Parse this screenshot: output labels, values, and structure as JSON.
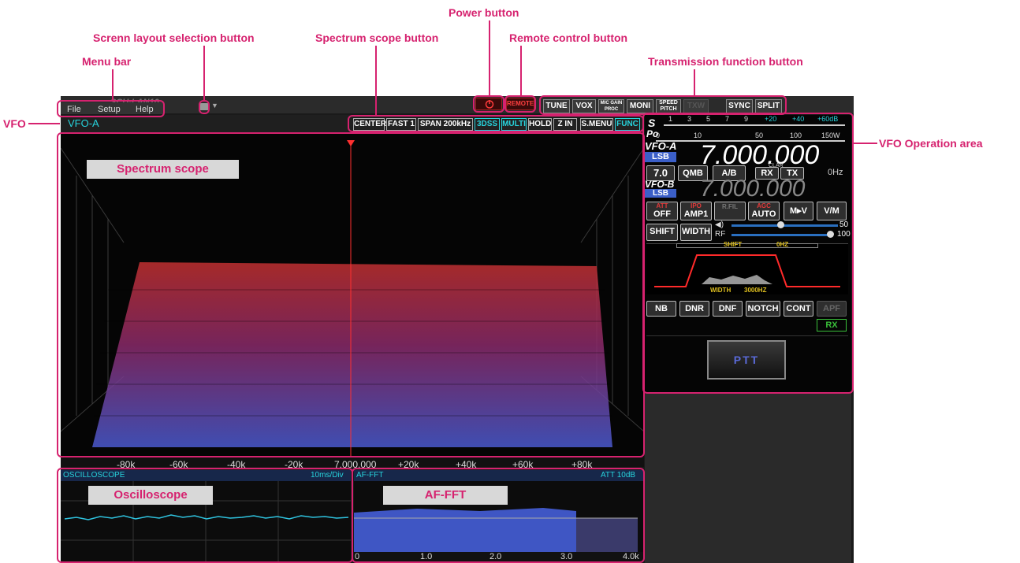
{
  "callouts": {
    "power": "Power button",
    "layout": "Screnn layout selection button",
    "scope_btn": "Spectrum scope button",
    "remote": "Remote control button",
    "menu": "Menu bar",
    "tx": "Transmission function button",
    "vfo": "VFO",
    "vfo_op": "VFO Operation area"
  },
  "app": {
    "title": "SCU-LAN10",
    "menu": [
      "File",
      "Setup",
      "Help"
    ],
    "vfo_label": "VFO-A",
    "remote_label": "REMOTE"
  },
  "tx_buttons": [
    "TUNE",
    "VOX",
    "MIC GAIN PROC",
    "MONI",
    "SPEED PITCH",
    "TXW",
    "SYNC",
    "SPLIT"
  ],
  "scope_buttons": [
    "CENTER",
    "FAST 1",
    "SPAN 200kHz",
    "3DSS",
    "MULTI",
    "HOLD",
    "Z IN",
    "S.MENU",
    "FUNC"
  ],
  "spectrum": {
    "label": "Spectrum scope",
    "ticks": [
      "-80k",
      "-60k",
      "-40k",
      "-20k",
      "7.000.000",
      "+20k",
      "+40k",
      "+60k",
      "+80k"
    ]
  },
  "oscilloscope": {
    "header": "OSCILLOSCOPE",
    "rate": "10ms/Div",
    "label": "Oscilloscope"
  },
  "affft": {
    "header": "AF-FFT",
    "att": "ATT 10dB",
    "label": "AF-FFT",
    "ticks": [
      "0",
      "1.0",
      "2.0",
      "3.0",
      "4.0k"
    ]
  },
  "vfo_panel": {
    "s_label": "S",
    "s_scale": [
      "1",
      "3",
      "5",
      "7",
      "9",
      "+20",
      "+40",
      "+60dB"
    ],
    "po_label": "Po",
    "po_scale": [
      "0",
      "10",
      "50",
      "100",
      "150W"
    ],
    "vfo_a": "VFO-A",
    "mode_a": "LSB",
    "freq_a": "7.000.000",
    "band": "7.0",
    "qmb": "QMB",
    "ab": "A/B",
    "clar": "CLAR",
    "rx": "RX",
    "tx": "TX",
    "clar_hz": "0Hz",
    "vfo_b": "VFO-B",
    "mode_b": "LSB",
    "freq_b": "7.000.000",
    "att_top": "ATT",
    "att_val": "OFF",
    "ipo_top": "IPO",
    "ipo_val": "AMP1",
    "rfil": "R.FIL",
    "agc_top": "AGC",
    "agc_val": "AUTO",
    "mv": "M▸V",
    "vm": "V/M",
    "shift": "SHIFT",
    "width": "WIDTH",
    "af_val": "50",
    "rf_label": "RF",
    "rf_val": "100",
    "shift_bar": "SHIFT",
    "shift_hz": "0HZ",
    "width_text": "WIDTH",
    "width_hz": "3000HZ",
    "nb": "NB",
    "dnr": "DNR",
    "dnf": "DNF",
    "notch": "NOTCH",
    "cont": "CONT",
    "apf": "APF",
    "rx_status": "RX",
    "ptt": "PTT"
  }
}
